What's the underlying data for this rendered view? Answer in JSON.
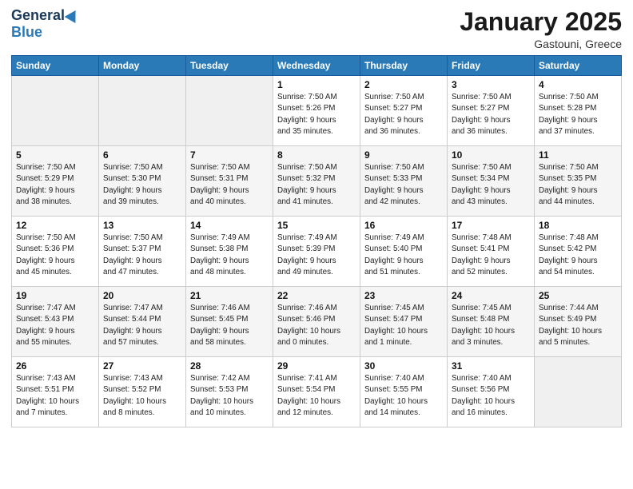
{
  "header": {
    "logo_line1": "General",
    "logo_line2": "Blue",
    "title": "January 2025",
    "location": "Gastouni, Greece"
  },
  "weekdays": [
    "Sunday",
    "Monday",
    "Tuesday",
    "Wednesday",
    "Thursday",
    "Friday",
    "Saturday"
  ],
  "weeks": [
    [
      {
        "day": "",
        "info": ""
      },
      {
        "day": "",
        "info": ""
      },
      {
        "day": "",
        "info": ""
      },
      {
        "day": "1",
        "info": "Sunrise: 7:50 AM\nSunset: 5:26 PM\nDaylight: 9 hours\nand 35 minutes."
      },
      {
        "day": "2",
        "info": "Sunrise: 7:50 AM\nSunset: 5:27 PM\nDaylight: 9 hours\nand 36 minutes."
      },
      {
        "day": "3",
        "info": "Sunrise: 7:50 AM\nSunset: 5:27 PM\nDaylight: 9 hours\nand 36 minutes."
      },
      {
        "day": "4",
        "info": "Sunrise: 7:50 AM\nSunset: 5:28 PM\nDaylight: 9 hours\nand 37 minutes."
      }
    ],
    [
      {
        "day": "5",
        "info": "Sunrise: 7:50 AM\nSunset: 5:29 PM\nDaylight: 9 hours\nand 38 minutes."
      },
      {
        "day": "6",
        "info": "Sunrise: 7:50 AM\nSunset: 5:30 PM\nDaylight: 9 hours\nand 39 minutes."
      },
      {
        "day": "7",
        "info": "Sunrise: 7:50 AM\nSunset: 5:31 PM\nDaylight: 9 hours\nand 40 minutes."
      },
      {
        "day": "8",
        "info": "Sunrise: 7:50 AM\nSunset: 5:32 PM\nDaylight: 9 hours\nand 41 minutes."
      },
      {
        "day": "9",
        "info": "Sunrise: 7:50 AM\nSunset: 5:33 PM\nDaylight: 9 hours\nand 42 minutes."
      },
      {
        "day": "10",
        "info": "Sunrise: 7:50 AM\nSunset: 5:34 PM\nDaylight: 9 hours\nand 43 minutes."
      },
      {
        "day": "11",
        "info": "Sunrise: 7:50 AM\nSunset: 5:35 PM\nDaylight: 9 hours\nand 44 minutes."
      }
    ],
    [
      {
        "day": "12",
        "info": "Sunrise: 7:50 AM\nSunset: 5:36 PM\nDaylight: 9 hours\nand 45 minutes."
      },
      {
        "day": "13",
        "info": "Sunrise: 7:50 AM\nSunset: 5:37 PM\nDaylight: 9 hours\nand 47 minutes."
      },
      {
        "day": "14",
        "info": "Sunrise: 7:49 AM\nSunset: 5:38 PM\nDaylight: 9 hours\nand 48 minutes."
      },
      {
        "day": "15",
        "info": "Sunrise: 7:49 AM\nSunset: 5:39 PM\nDaylight: 9 hours\nand 49 minutes."
      },
      {
        "day": "16",
        "info": "Sunrise: 7:49 AM\nSunset: 5:40 PM\nDaylight: 9 hours\nand 51 minutes."
      },
      {
        "day": "17",
        "info": "Sunrise: 7:48 AM\nSunset: 5:41 PM\nDaylight: 9 hours\nand 52 minutes."
      },
      {
        "day": "18",
        "info": "Sunrise: 7:48 AM\nSunset: 5:42 PM\nDaylight: 9 hours\nand 54 minutes."
      }
    ],
    [
      {
        "day": "19",
        "info": "Sunrise: 7:47 AM\nSunset: 5:43 PM\nDaylight: 9 hours\nand 55 minutes."
      },
      {
        "day": "20",
        "info": "Sunrise: 7:47 AM\nSunset: 5:44 PM\nDaylight: 9 hours\nand 57 minutes."
      },
      {
        "day": "21",
        "info": "Sunrise: 7:46 AM\nSunset: 5:45 PM\nDaylight: 9 hours\nand 58 minutes."
      },
      {
        "day": "22",
        "info": "Sunrise: 7:46 AM\nSunset: 5:46 PM\nDaylight: 10 hours\nand 0 minutes."
      },
      {
        "day": "23",
        "info": "Sunrise: 7:45 AM\nSunset: 5:47 PM\nDaylight: 10 hours\nand 1 minute."
      },
      {
        "day": "24",
        "info": "Sunrise: 7:45 AM\nSunset: 5:48 PM\nDaylight: 10 hours\nand 3 minutes."
      },
      {
        "day": "25",
        "info": "Sunrise: 7:44 AM\nSunset: 5:49 PM\nDaylight: 10 hours\nand 5 minutes."
      }
    ],
    [
      {
        "day": "26",
        "info": "Sunrise: 7:43 AM\nSunset: 5:51 PM\nDaylight: 10 hours\nand 7 minutes."
      },
      {
        "day": "27",
        "info": "Sunrise: 7:43 AM\nSunset: 5:52 PM\nDaylight: 10 hours\nand 8 minutes."
      },
      {
        "day": "28",
        "info": "Sunrise: 7:42 AM\nSunset: 5:53 PM\nDaylight: 10 hours\nand 10 minutes."
      },
      {
        "day": "29",
        "info": "Sunrise: 7:41 AM\nSunset: 5:54 PM\nDaylight: 10 hours\nand 12 minutes."
      },
      {
        "day": "30",
        "info": "Sunrise: 7:40 AM\nSunset: 5:55 PM\nDaylight: 10 hours\nand 14 minutes."
      },
      {
        "day": "31",
        "info": "Sunrise: 7:40 AM\nSunset: 5:56 PM\nDaylight: 10 hours\nand 16 minutes."
      },
      {
        "day": "",
        "info": ""
      }
    ]
  ]
}
